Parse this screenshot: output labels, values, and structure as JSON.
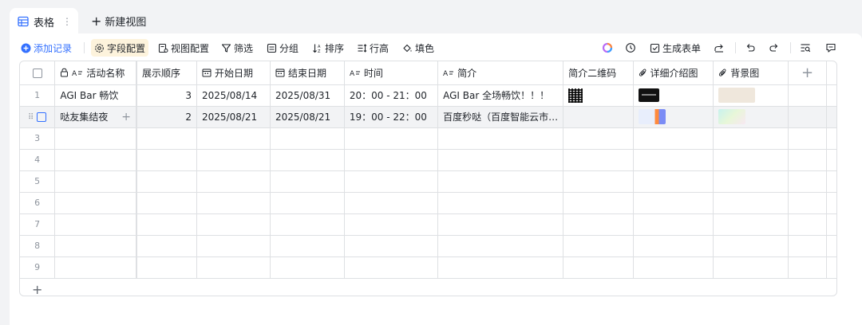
{
  "tabs": {
    "active_label": "表格",
    "new_view_label": "新建视图"
  },
  "toolbar": {
    "add_record": "添加记录",
    "field_config": "字段配置",
    "view_config": "视图配置",
    "filter": "筛选",
    "group": "分组",
    "sort": "排序",
    "row_height": "行高",
    "fill_color": "填色",
    "generate_form": "生成表单"
  },
  "columns": [
    {
      "label": "活动名称",
      "icon": "text-field-icon",
      "primary": true
    },
    {
      "label": "展示顺序",
      "icon": "number-field-icon"
    },
    {
      "label": "开始日期",
      "icon": "date-field-icon"
    },
    {
      "label": "结束日期",
      "icon": "date-field-icon"
    },
    {
      "label": "时间",
      "icon": "text-field-icon"
    },
    {
      "label": "简介",
      "icon": "text-field-icon"
    },
    {
      "label": "简介二维码",
      "icon": "attachment-field-icon"
    },
    {
      "label": "详细介绍图",
      "icon": "attachment-field-icon"
    },
    {
      "label": "背景图",
      "icon": "attachment-field-icon"
    }
  ],
  "rows": [
    {
      "index": "1",
      "name": "AGI Bar 畅饮",
      "order": "3",
      "start": "2025/08/14",
      "end": "2025/08/31",
      "time": "20：00 - 21：00",
      "intro": "AGI Bar 全场畅饮！！！",
      "qr": true,
      "detail_color": "#111111",
      "bg_color": "#efe7dc"
    },
    {
      "index": "2",
      "name": "哒友集结夜",
      "order": "2",
      "start": "2025/08/21",
      "end": "2025/08/21",
      "time": "19：00 - 22：00",
      "intro": "百度秒哒（百度智能云市…",
      "qr": false,
      "detail_color": "#c9d6f5",
      "bg_color": "#d9f3f0"
    }
  ],
  "empty_rows": [
    "3",
    "4",
    "5",
    "6",
    "7",
    "8",
    "9"
  ],
  "colors": {
    "accent": "#3370ff",
    "field_config_bg": "#fdf3dc"
  }
}
